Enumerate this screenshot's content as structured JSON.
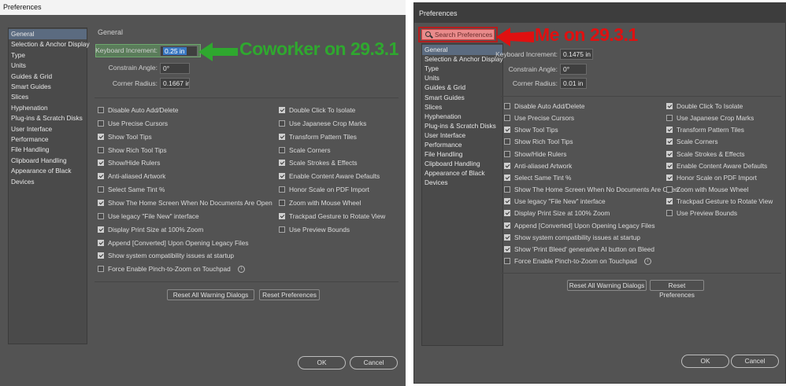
{
  "left": {
    "title": "Preferences",
    "sidebar": [
      "General",
      "Selection & Anchor Display",
      "Type",
      "Units",
      "Guides & Grid",
      "Smart Guides",
      "Slices",
      "Hyphenation",
      "Plug-ins & Scratch Disks",
      "User Interface",
      "Performance",
      "File Handling",
      "Clipboard Handling",
      "Appearance of Black",
      "Devices"
    ],
    "section": "General",
    "fields": [
      {
        "label": "Keyboard Increment:",
        "value": "0.25 in"
      },
      {
        "label": "Constrain Angle:",
        "value": "0°"
      },
      {
        "label": "Corner Radius:",
        "value": "0.1667 in"
      }
    ],
    "col1": [
      {
        "label": "Disable Auto Add/Delete",
        "checked": false
      },
      {
        "label": "Use Precise Cursors",
        "checked": false
      },
      {
        "label": "Show Tool Tips",
        "checked": true
      },
      {
        "label": "Show Rich Tool Tips",
        "checked": false
      },
      {
        "label": "Show/Hide Rulers",
        "checked": true
      },
      {
        "label": "Anti-aliased Artwork",
        "checked": true
      },
      {
        "label": "Select Same Tint %",
        "checked": false
      },
      {
        "label": "Show The Home Screen When No Documents Are Open",
        "checked": true
      },
      {
        "label": "Use legacy \"File New\" interface",
        "checked": false
      },
      {
        "label": "Display Print Size at 100% Zoom",
        "checked": true
      },
      {
        "label": "Append [Converted] Upon Opening Legacy Files",
        "checked": true
      },
      {
        "label": "Show system compatibility issues at startup",
        "checked": true
      },
      {
        "label": "Force Enable Pinch-to-Zoom on Touchpad",
        "checked": false,
        "info": true
      }
    ],
    "col2": [
      {
        "label": "Double Click To Isolate",
        "checked": true
      },
      {
        "label": "Use Japanese Crop Marks",
        "checked": false
      },
      {
        "label": "Transform Pattern Tiles",
        "checked": true
      },
      {
        "label": "Scale Corners",
        "checked": false
      },
      {
        "label": "Scale Strokes & Effects",
        "checked": true
      },
      {
        "label": "Enable Content Aware Defaults",
        "checked": true
      },
      {
        "label": "Honor Scale on PDF Import",
        "checked": false
      },
      {
        "label": "Zoom with Mouse Wheel",
        "checked": false
      },
      {
        "label": "Trackpad Gesture to Rotate View",
        "checked": true
      },
      {
        "label": "Use Preview Bounds",
        "checked": false
      }
    ],
    "reset_warnings": "Reset All Warning Dialogs",
    "reset_prefs": "Reset Preferences",
    "ok": "OK",
    "cancel": "Cancel",
    "annotation": "Coworker on 29.3.1"
  },
  "right": {
    "title": "Preferences",
    "search_placeholder": "Search Preferences",
    "sidebar": [
      "General",
      "Selection & Anchor Display",
      "Type",
      "Units",
      "Guides & Grid",
      "Smart Guides",
      "Slices",
      "Hyphenation",
      "Plug-ins & Scratch Disks",
      "User Interface",
      "Performance",
      "File Handling",
      "Clipboard Handling",
      "Appearance of Black",
      "Devices"
    ],
    "fields": [
      {
        "label": "Keyboard Increment:",
        "value": "0.1475 in"
      },
      {
        "label": "Constrain Angle:",
        "value": "0°"
      },
      {
        "label": "Corner Radius:",
        "value": "0.01 in"
      }
    ],
    "col1": [
      {
        "label": "Disable Auto Add/Delete",
        "checked": false
      },
      {
        "label": "Use Precise Cursors",
        "checked": false
      },
      {
        "label": "Show Tool Tips",
        "checked": true
      },
      {
        "label": "Show Rich Tool Tips",
        "checked": false
      },
      {
        "label": "Show/Hide Rulers",
        "checked": false
      },
      {
        "label": "Anti-aliased Artwork",
        "checked": true
      },
      {
        "label": "Select Same Tint %",
        "checked": true
      },
      {
        "label": "Show The Home Screen When No Documents Are Open",
        "checked": false
      },
      {
        "label": "Use legacy \"File New\" interface",
        "checked": true
      },
      {
        "label": "Display Print Size at 100% Zoom",
        "checked": true
      },
      {
        "label": "Append [Converted] Upon Opening Legacy Files",
        "checked": true
      },
      {
        "label": "Show system compatibility issues at startup",
        "checked": true
      },
      {
        "label": "Show 'Print Bleed' generative AI button on Bleed",
        "checked": true
      },
      {
        "label": "Force Enable Pinch-to-Zoom on Touchpad",
        "checked": false,
        "info": true
      }
    ],
    "col2": [
      {
        "label": "Double Click To Isolate",
        "checked": true
      },
      {
        "label": "Use Japanese Crop Marks",
        "checked": false
      },
      {
        "label": "Transform Pattern Tiles",
        "checked": true
      },
      {
        "label": "Scale Corners",
        "checked": true
      },
      {
        "label": "Scale Strokes & Effects",
        "checked": true
      },
      {
        "label": "Enable Content Aware Defaults",
        "checked": true
      },
      {
        "label": "Honor Scale on PDF Import",
        "checked": true
      },
      {
        "label": "Zoom with Mouse Wheel",
        "checked": false
      },
      {
        "label": "Trackpad Gesture to Rotate View",
        "checked": true
      },
      {
        "label": "Use Preview Bounds",
        "checked": false
      }
    ],
    "reset_warnings": "Reset All Warning Dialogs",
    "reset_prefs": "Reset Preferences",
    "ok": "OK",
    "cancel": "Cancel",
    "annotation": "Me on 29.3.1"
  },
  "colors": {
    "annotation_green": "#2fa82f",
    "annotation_red": "#e01010"
  }
}
